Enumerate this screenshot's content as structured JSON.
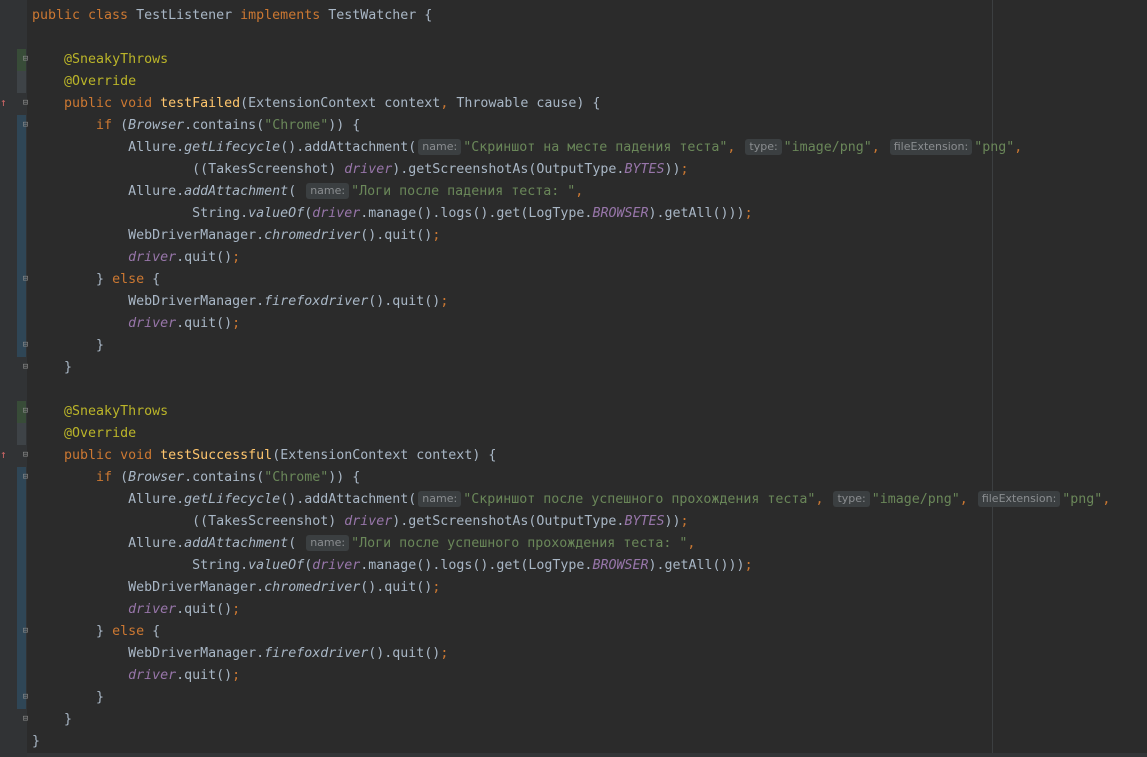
{
  "editor": {
    "language": "java",
    "line_numbers_visible": false,
    "hint_labels": {
      "name": "name:",
      "type": "type:",
      "file_extension": "fileExtension:"
    },
    "lines": [
      [
        [
          "kw",
          "public class "
        ],
        [
          "t",
          "TestListener "
        ],
        [
          "kw",
          "implements "
        ],
        [
          "t",
          "TestWatcher {"
        ]
      ],
      [],
      [
        [
          "t",
          "    "
        ],
        [
          "ann",
          "@SneakyThrows"
        ]
      ],
      [
        [
          "t",
          "    "
        ],
        [
          "ann",
          "@Override"
        ]
      ],
      [
        [
          "t",
          "    "
        ],
        [
          "kw",
          "public void "
        ],
        [
          "fn",
          "testFailed"
        ],
        [
          "t",
          "(ExtensionContext context"
        ],
        [
          "kw",
          ", "
        ],
        [
          "t",
          "Throwable cause) {"
        ]
      ],
      [
        [
          "t",
          "        "
        ],
        [
          "kw",
          "if "
        ],
        [
          "t",
          "("
        ],
        [
          "cls",
          "Browser"
        ],
        [
          "t",
          ".contains("
        ],
        [
          "str",
          "\"Chrome\""
        ],
        [
          "t",
          ")) {"
        ]
      ],
      [
        [
          "t",
          "            Allure."
        ],
        [
          "cls",
          "getLifecycle"
        ],
        [
          "t",
          "().addAttachment("
        ],
        [
          "hint",
          "name:"
        ],
        [
          "str",
          "\"Скриншот на месте падения теста\""
        ],
        [
          "kw",
          ", "
        ],
        [
          "hint",
          "type:"
        ],
        [
          "str",
          "\"image/png\""
        ],
        [
          "kw",
          ", "
        ],
        [
          "hint",
          "fileExtension:"
        ],
        [
          "str",
          "\"png\""
        ],
        [
          "kw",
          ","
        ]
      ],
      [
        [
          "t",
          "                    ((TakesScreenshot) "
        ],
        [
          "field",
          "driver"
        ],
        [
          "t",
          ").getScreenshotAs(OutputType."
        ],
        [
          "cnst",
          "BYTES"
        ],
        [
          "t",
          "))"
        ],
        [
          "kw",
          ";"
        ]
      ],
      [
        [
          "t",
          "            Allure."
        ],
        [
          "cls",
          "addAttachment"
        ],
        [
          "t",
          "( "
        ],
        [
          "hint",
          "name:"
        ],
        [
          "str",
          "\"Логи после падения теста: \""
        ],
        [
          "kw",
          ","
        ]
      ],
      [
        [
          "t",
          "                    String."
        ],
        [
          "cls",
          "valueOf"
        ],
        [
          "t",
          "("
        ],
        [
          "field",
          "driver"
        ],
        [
          "t",
          ".manage().logs().get(LogType."
        ],
        [
          "cnst",
          "BROWSER"
        ],
        [
          "t",
          ").getAll()))"
        ],
        [
          "kw",
          ";"
        ]
      ],
      [
        [
          "t",
          "            WebDriverManager."
        ],
        [
          "cls",
          "chromedriver"
        ],
        [
          "t",
          "().quit()"
        ],
        [
          "kw",
          ";"
        ]
      ],
      [
        [
          "t",
          "            "
        ],
        [
          "field",
          "driver"
        ],
        [
          "t",
          ".quit()"
        ],
        [
          "kw",
          ";"
        ]
      ],
      [
        [
          "t",
          "        } "
        ],
        [
          "kw",
          "else "
        ],
        [
          "t",
          "{"
        ]
      ],
      [
        [
          "t",
          "            WebDriverManager."
        ],
        [
          "cls",
          "firefoxdriver"
        ],
        [
          "t",
          "().quit()"
        ],
        [
          "kw",
          ";"
        ]
      ],
      [
        [
          "t",
          "            "
        ],
        [
          "field",
          "driver"
        ],
        [
          "t",
          ".quit()"
        ],
        [
          "kw",
          ";"
        ]
      ],
      [
        [
          "t",
          "        }"
        ]
      ],
      [
        [
          "t",
          "    }"
        ]
      ],
      [],
      [
        [
          "t",
          "    "
        ],
        [
          "ann",
          "@SneakyThrows"
        ]
      ],
      [
        [
          "t",
          "    "
        ],
        [
          "ann",
          "@Override"
        ]
      ],
      [
        [
          "t",
          "    "
        ],
        [
          "kw",
          "public void "
        ],
        [
          "fn",
          "testSuccessful"
        ],
        [
          "t",
          "(ExtensionContext context) {"
        ]
      ],
      [
        [
          "t",
          "        "
        ],
        [
          "kw",
          "if "
        ],
        [
          "t",
          "("
        ],
        [
          "cls",
          "Browser"
        ],
        [
          "t",
          ".contains("
        ],
        [
          "str",
          "\"Chrome\""
        ],
        [
          "t",
          ")) {"
        ]
      ],
      [
        [
          "t",
          "            Allure."
        ],
        [
          "cls",
          "getLifecycle"
        ],
        [
          "t",
          "().addAttachment("
        ],
        [
          "hint",
          "name:"
        ],
        [
          "str",
          "\"Скриншот после успешного прохождения теста\""
        ],
        [
          "kw",
          ", "
        ],
        [
          "hint",
          "type:"
        ],
        [
          "str",
          "\"image/png\""
        ],
        [
          "kw",
          ", "
        ],
        [
          "hint",
          "fileExtension:"
        ],
        [
          "str",
          "\"png\""
        ],
        [
          "kw",
          ","
        ]
      ],
      [
        [
          "t",
          "                    ((TakesScreenshot) "
        ],
        [
          "field",
          "driver"
        ],
        [
          "t",
          ").getScreenshotAs(OutputType."
        ],
        [
          "cnst",
          "BYTES"
        ],
        [
          "t",
          "))"
        ],
        [
          "kw",
          ";"
        ]
      ],
      [
        [
          "t",
          "            Allure."
        ],
        [
          "cls",
          "addAttachment"
        ],
        [
          "t",
          "( "
        ],
        [
          "hint",
          "name:"
        ],
        [
          "str",
          "\"Логи после успешного прохождения теста: \""
        ],
        [
          "kw",
          ","
        ]
      ],
      [
        [
          "t",
          "                    String."
        ],
        [
          "cls",
          "valueOf"
        ],
        [
          "t",
          "("
        ],
        [
          "field",
          "driver"
        ],
        [
          "t",
          ".manage().logs().get(LogType."
        ],
        [
          "cnst",
          "BROWSER"
        ],
        [
          "t",
          ").getAll()))"
        ],
        [
          "kw",
          ";"
        ]
      ],
      [
        [
          "t",
          "            WebDriverManager."
        ],
        [
          "cls",
          "chromedriver"
        ],
        [
          "t",
          "().quit()"
        ],
        [
          "kw",
          ";"
        ]
      ],
      [
        [
          "t",
          "            "
        ],
        [
          "field",
          "driver"
        ],
        [
          "t",
          ".quit()"
        ],
        [
          "kw",
          ";"
        ]
      ],
      [
        [
          "t",
          "        } "
        ],
        [
          "kw",
          "else "
        ],
        [
          "t",
          "{"
        ]
      ],
      [
        [
          "t",
          "            WebDriverManager."
        ],
        [
          "cls",
          "firefoxdriver"
        ],
        [
          "t",
          "().quit()"
        ],
        [
          "kw",
          ";"
        ]
      ],
      [
        [
          "t",
          "            "
        ],
        [
          "field",
          "driver"
        ],
        [
          "t",
          ".quit()"
        ],
        [
          "kw",
          ";"
        ]
      ],
      [
        [
          "t",
          "        }"
        ]
      ],
      [
        [
          "t",
          "    }"
        ]
      ],
      [
        [
          "t",
          "}"
        ]
      ]
    ]
  },
  "gutter": {
    "override_marker_icon": "override-method-icon",
    "fold_icon": "fold-toggle-icon",
    "fold_glyph": "⊟",
    "marker_glyph": "↑",
    "colors": {
      "background": "#313335",
      "changed": "#2f4656",
      "added": "#384c38"
    }
  }
}
